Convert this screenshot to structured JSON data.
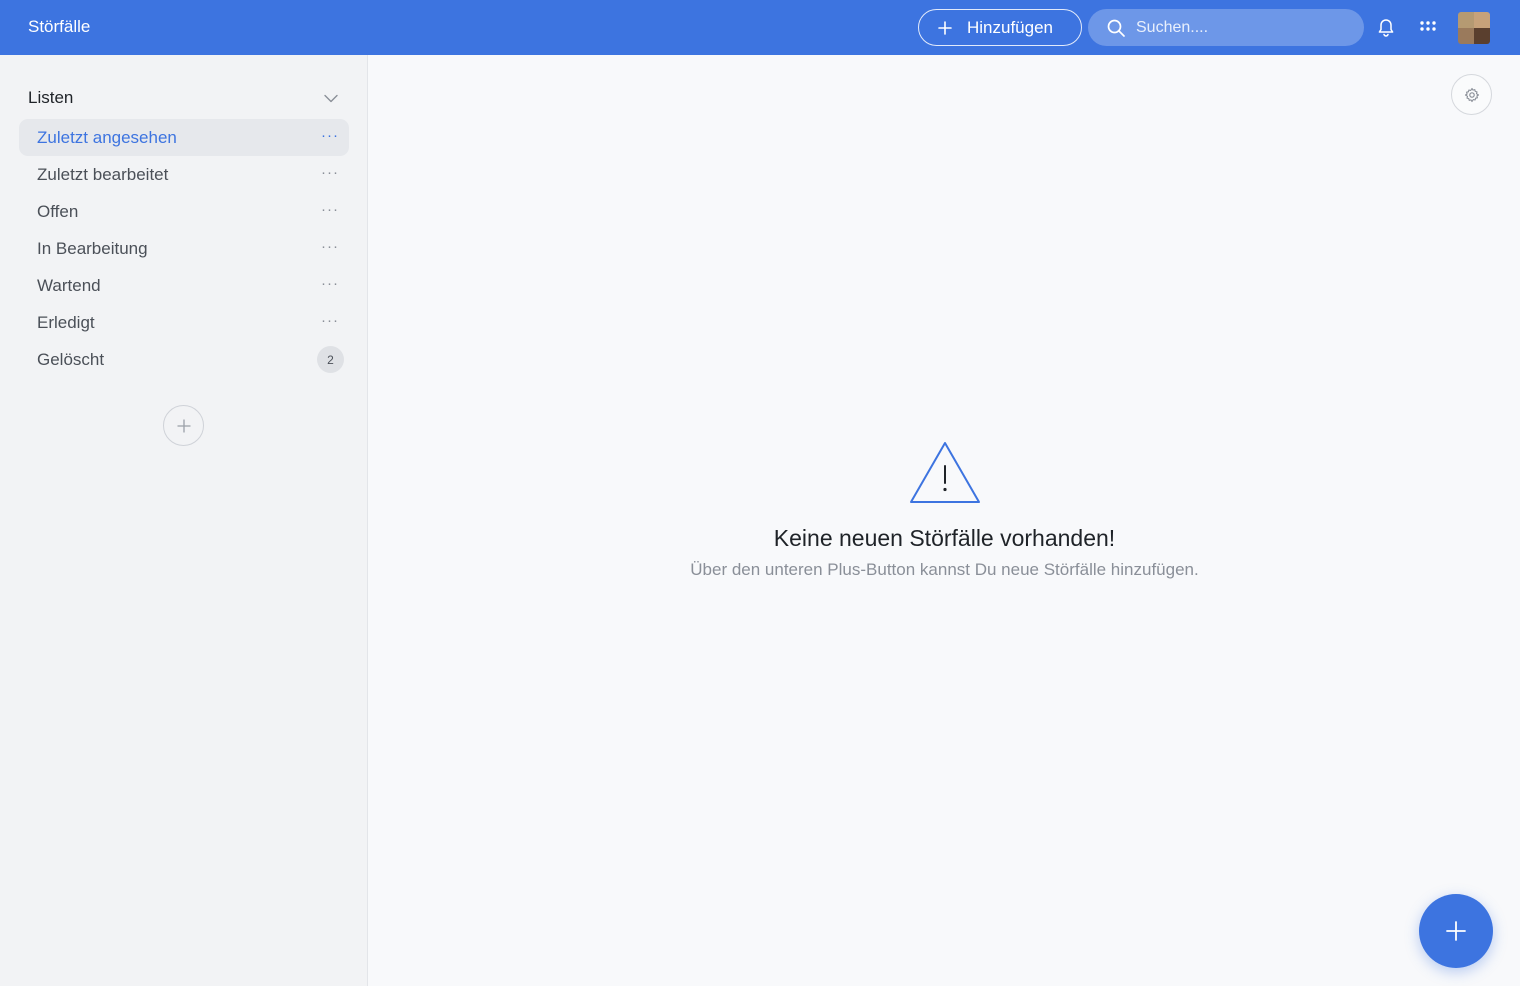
{
  "header": {
    "title": "Störfälle",
    "add_label": "Hinzufügen",
    "search_placeholder": "Suchen...."
  },
  "sidebar": {
    "title": "Listen",
    "items": [
      {
        "label": "Zuletzt angesehen",
        "active": true
      },
      {
        "label": "Zuletzt bearbeitet"
      },
      {
        "label": "Offen"
      },
      {
        "label": "In Bearbeitung"
      },
      {
        "label": "Wartend"
      },
      {
        "label": "Erledigt"
      },
      {
        "label": "Gelöscht",
        "count": "2"
      }
    ],
    "more_glyph": "···"
  },
  "empty_state": {
    "title": "Keine neuen Störfälle vorhanden!",
    "subtitle": "Über den unteren Plus-Button kannst Du neue Störfälle hinzufügen."
  },
  "colors": {
    "accent": "#3d74e0",
    "sidebar_bg": "#f2f3f5",
    "main_bg": "#f8f9fb"
  }
}
